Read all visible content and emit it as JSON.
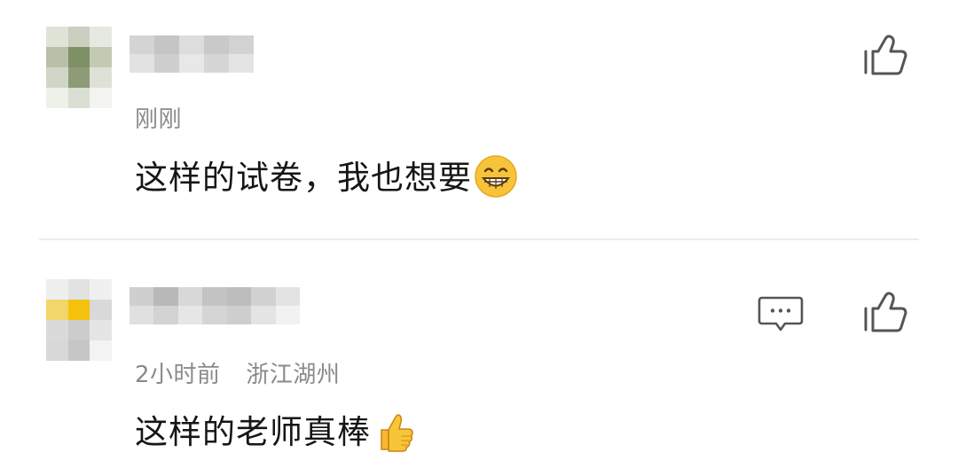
{
  "comments": [
    {
      "time": "刚刚",
      "location": "",
      "text": "这样的试卷，我也想要",
      "emoji": "grinning-face-emoji",
      "actions": {
        "like_icon": "thumbs-up-outline-icon"
      }
    },
    {
      "time": "2小时前",
      "location": "浙江湖州",
      "text": "这样的老师真棒",
      "emoji": "thumbs-up-emoji",
      "actions": {
        "reply_icon": "comment-bubble-icon",
        "like_icon": "thumbs-up-outline-icon"
      }
    }
  ],
  "colors": {
    "meta_text": "#8a8a8a",
    "body_text": "#161616",
    "icon_stroke": "#555555",
    "divider": "#ececec",
    "emoji_yellow": "#f7c33a"
  }
}
